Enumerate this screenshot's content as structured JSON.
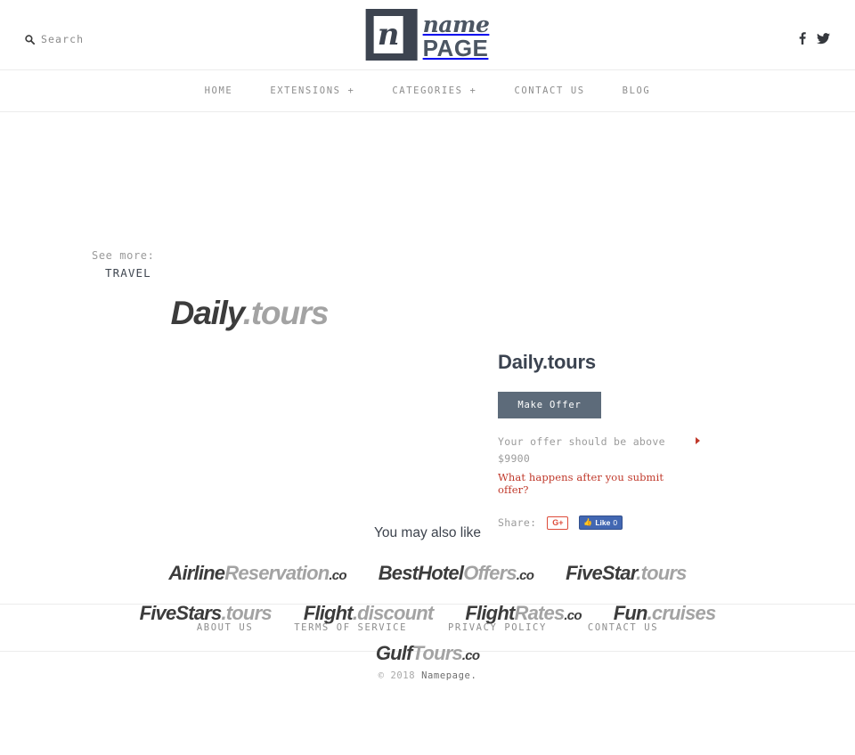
{
  "header": {
    "search": {
      "label": "Search",
      "icon": "search-icon"
    },
    "logo": {
      "mark_letter": "n",
      "name": "name",
      "page": "PAGE"
    },
    "social": [
      {
        "name": "facebook-icon",
        "glyph": "f"
      },
      {
        "name": "twitter-icon",
        "glyph": "bird"
      }
    ]
  },
  "nav": {
    "items": [
      {
        "label": "HOME"
      },
      {
        "label": "EXTENSIONS +"
      },
      {
        "label": "CATEGORIES +"
      },
      {
        "label": "CONTACT US"
      },
      {
        "label": "BLOG"
      }
    ]
  },
  "see_more": {
    "label": "See more:",
    "category": "TRAVEL"
  },
  "domain_art": {
    "prefix": "Daily",
    "suffix": ".tours"
  },
  "panel": {
    "title": "Daily.tours",
    "make_offer_label": "Make Offer",
    "offer_note_line1": "Your offer should be above",
    "offer_note_line2": "$9900",
    "offer_link": "What happens after you submit offer?",
    "share_label": "Share:",
    "gplus_label": "G+",
    "fb_like_label": "Like",
    "fb_like_count": "0"
  },
  "also_like": {
    "heading": "You may also like",
    "rows": [
      [
        {
          "prefix": "Airline",
          "mid": "Reservation",
          "suffix": ".co",
          "suffix_small": true
        },
        {
          "prefix": "BestHotel",
          "mid": "Offers",
          "suffix": ".co",
          "suffix_small": true
        },
        {
          "prefix": "FiveStar",
          "mid": ".tours",
          "suffix": "",
          "suffix_small": false
        }
      ],
      [
        {
          "prefix": "FiveStars",
          "mid": ".tours",
          "suffix": "",
          "suffix_small": false
        },
        {
          "prefix": "Flight",
          "mid": ".discount",
          "suffix": "",
          "suffix_small": false
        },
        {
          "prefix": "Flight",
          "mid": "Rates",
          "suffix": ".co",
          "suffix_small": true
        },
        {
          "prefix": "Fun",
          "mid": ".cruises",
          "suffix": "",
          "suffix_small": false
        }
      ],
      [
        {
          "prefix": "Gulf",
          "mid": "Tours",
          "suffix": ".co",
          "suffix_small": true
        }
      ]
    ]
  },
  "footer": {
    "links": [
      {
        "label": "ABOUT US"
      },
      {
        "label": "TERMS OF SERVICE"
      },
      {
        "label": "PRIVACY POLICY"
      },
      {
        "label": "CONTACT US"
      }
    ],
    "copyright_prefix": "© 2018 ",
    "copyright_brand": "Namepage."
  },
  "colors": {
    "accent_button": "#5d6b7a",
    "accent_red": "#c0392b",
    "logo_navy": "#4c5663",
    "facebook_blue": "#4267b2",
    "gplus_red": "#dd4b39"
  }
}
